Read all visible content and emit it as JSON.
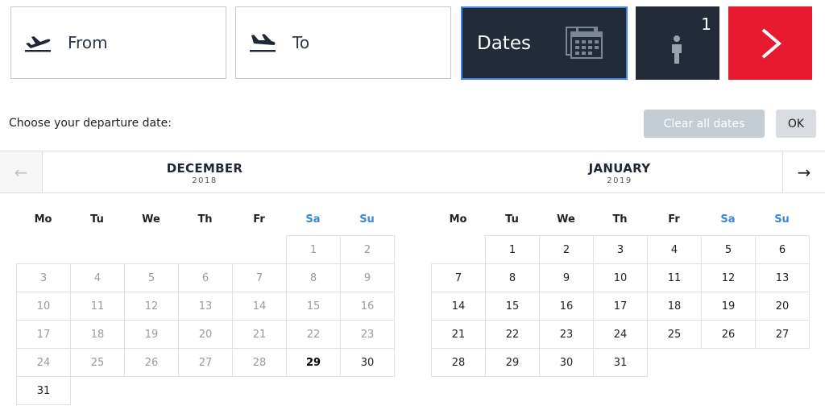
{
  "search": {
    "from_label": "From",
    "to_label": "To",
    "dates_label": "Dates",
    "passenger_count": "1",
    "colors": {
      "dark": "#222b37",
      "accent": "#e6192f",
      "focus": "#3d86e0",
      "weekend": "#3b87d8"
    }
  },
  "picker": {
    "prompt": "Choose your departure date:",
    "clear_label": "Clear all dates",
    "ok_label": "OK",
    "weekdays": [
      "Mo",
      "Tu",
      "We",
      "Th",
      "Fr",
      "Sa",
      "Su"
    ],
    "months": [
      {
        "name": "DECEMBER",
        "year": "2018",
        "first_weekday_index": 5,
        "days_in_month": 31,
        "past_until": 28,
        "today": 29
      },
      {
        "name": "JANUARY",
        "year": "2019",
        "first_weekday_index": 1,
        "days_in_month": 31,
        "past_until": 0,
        "today": null
      }
    ]
  }
}
